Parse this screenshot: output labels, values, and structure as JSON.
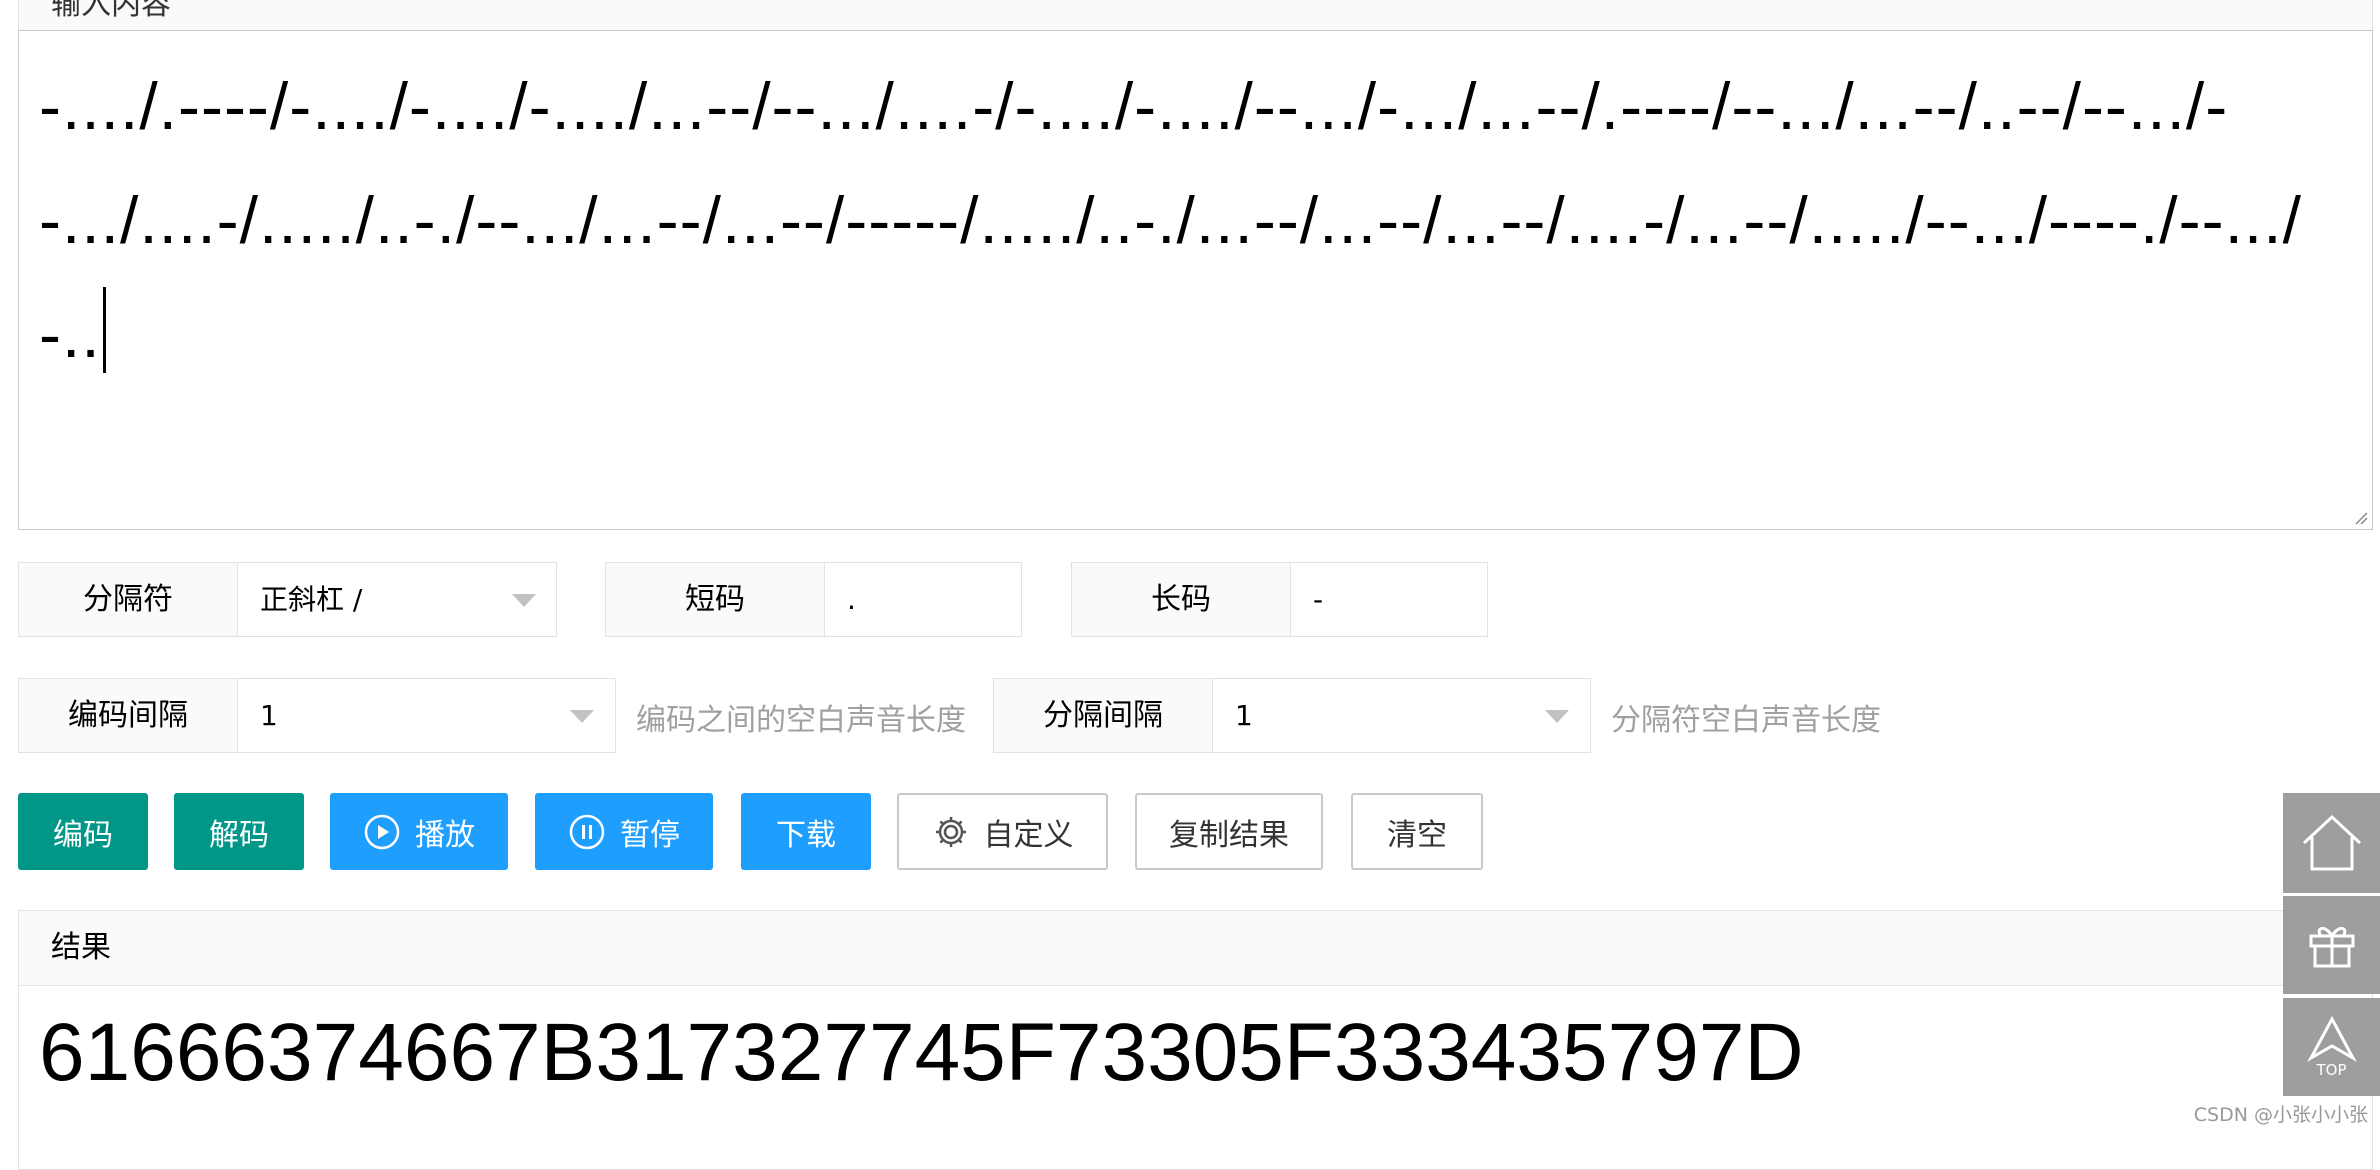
{
  "input": {
    "header_label": "输入内容",
    "text": "-..../.----/-..../-..../-..../...--/--.../....-/-..../-..../--.../-.../...--/.----/--.../...--/..--/--.../--.../....-/...../..-./--.../...--/...--/-----/...../..-./...--/...--/...--/....-/...--/...../--.../----./--.../-.."
  },
  "options": {
    "separator": {
      "label": "分隔符",
      "value": "正斜杠 /"
    },
    "short_code": {
      "label": "短码",
      "value": "."
    },
    "long_code": {
      "label": "长码",
      "value": "-"
    },
    "code_interval": {
      "label": "编码间隔",
      "value": "1",
      "hint": "编码之间的空白声音长度"
    },
    "separator_interval": {
      "label": "分隔间隔",
      "value": "1",
      "hint": "分隔符空白声音长度"
    }
  },
  "buttons": {
    "encode": "编码",
    "decode": "解码",
    "play": "播放",
    "pause": "暂停",
    "download": "下载",
    "custom": "自定义",
    "copy_result": "复制结果",
    "clear": "清空"
  },
  "result": {
    "header_label": "结果",
    "text": "61666374667B317327745F73305F333435797D"
  },
  "side_toolbar": {
    "top_label": "TOP"
  },
  "watermark": "CSDN @小张小小张",
  "colors": {
    "teal": "#009688",
    "blue": "#1e9fff",
    "side_gray": "#9e9e9e"
  }
}
